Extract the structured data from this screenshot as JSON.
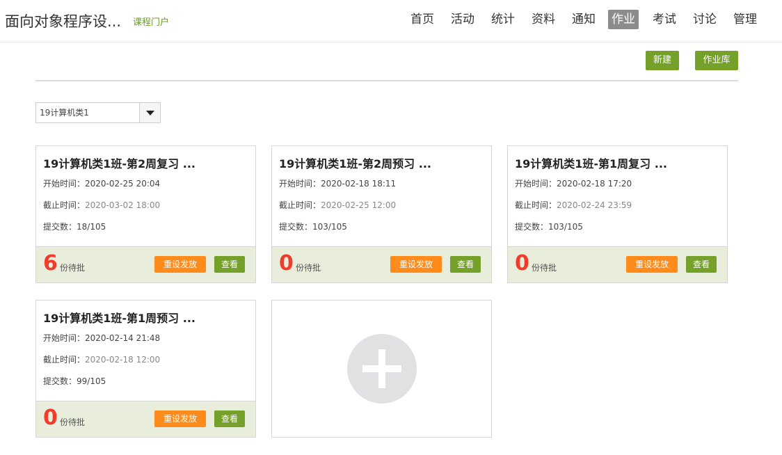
{
  "header": {
    "course_title": "面向对象程序设...",
    "portal_link": "课程门户",
    "nav": [
      {
        "label": "首页",
        "active": false
      },
      {
        "label": "活动",
        "active": false
      },
      {
        "label": "统计",
        "active": false
      },
      {
        "label": "资料",
        "active": false
      },
      {
        "label": "通知",
        "active": false
      },
      {
        "label": "作业",
        "active": true
      },
      {
        "label": "考试",
        "active": false
      },
      {
        "label": "讨论",
        "active": false
      },
      {
        "label": "管理",
        "active": false
      }
    ]
  },
  "toolbar": {
    "new_label": "新建",
    "library_label": "作业库"
  },
  "class_select": {
    "selected": "19计算机类1"
  },
  "labels": {
    "start": "开始时间：",
    "end": "截止时间：",
    "submit": "提交数：",
    "pending_suffix": "份待批",
    "reset_button": "重设发放",
    "view_button": "查看"
  },
  "assignments": [
    {
      "title": "19计算机类1班-第2周复习 ...",
      "start": "2020-02-25 20:04",
      "end": "2020-03-02 18:00",
      "submissions": "18/105",
      "pending": "6"
    },
    {
      "title": "19计算机类1班-第2周预习 ...",
      "start": "2020-02-18 18:11",
      "end": "2020-02-25 12:00",
      "submissions": "103/105",
      "pending": "0"
    },
    {
      "title": "19计算机类1班-第1周复习 ...",
      "start": "2020-02-18 17:20",
      "end": "2020-02-24 23:59",
      "submissions": "103/105",
      "pending": "0"
    },
    {
      "title": "19计算机类1班-第1周预习 ...",
      "start": "2020-02-14 21:48",
      "end": "2020-02-18 12:00",
      "submissions": "99/105",
      "pending": "0"
    }
  ],
  "colors": {
    "accent_green": "#75a02a",
    "accent_orange": "#ff8c1a",
    "pending_red": "#f03c2a",
    "footer_bg": "#e9eddb",
    "nav_active_bg": "#8c8c8c"
  },
  "icons": {
    "add_card": "plus-circle-icon",
    "select_arrow": "caret-down-icon"
  }
}
